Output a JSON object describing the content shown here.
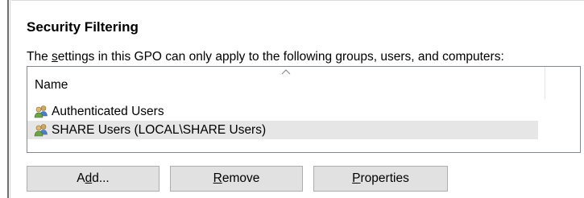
{
  "section": {
    "title": "Security Filtering",
    "description_pre": "The ",
    "description_accel": "s",
    "description_post": "ettings in this GPO can only apply to the following groups, users, and computers:"
  },
  "list": {
    "column_header": "Name",
    "sort_icon": "chevron-up-icon",
    "items": [
      {
        "label": "Authenticated Users",
        "icon": "users-group-icon",
        "selected": false
      },
      {
        "label": "SHARE Users (LOCAL\\SHARE Users)",
        "icon": "users-group-icon",
        "selected": true
      }
    ]
  },
  "buttons": {
    "add": {
      "pre": "A",
      "accel": "d",
      "post": "d..."
    },
    "remove": {
      "pre": "",
      "accel": "R",
      "post": "emove"
    },
    "properties": {
      "pre": "",
      "accel": "P",
      "post": "roperties"
    }
  },
  "colors": {
    "selection": "#e6e6e6",
    "button_face": "#e1e1e1",
    "border": "#828790"
  }
}
